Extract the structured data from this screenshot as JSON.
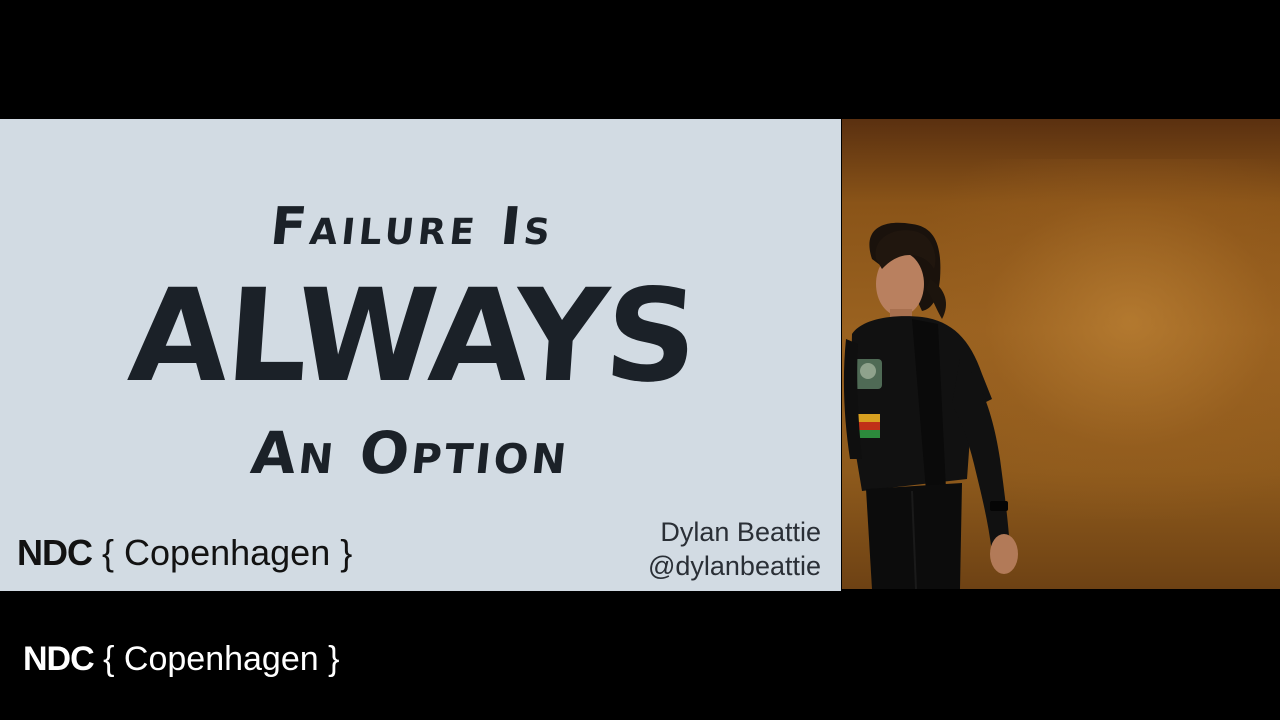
{
  "slide": {
    "title_line_1": "Failure Is",
    "title_line_2": "ALWAYS",
    "title_line_3": "An Option",
    "logo_brand": "NDC",
    "logo_city": " { Copenhagen }",
    "speaker_name": "Dylan Beattie",
    "speaker_handle": "@dylanbeattie"
  },
  "overlay": {
    "logo_brand": "NDC",
    "logo_city": " { Copenhagen }"
  },
  "colors": {
    "slide_background": "#d2dbe3",
    "title_ink": "#1b2128",
    "letterbox": "#000000",
    "stage_backdrop": "#9a6220"
  }
}
